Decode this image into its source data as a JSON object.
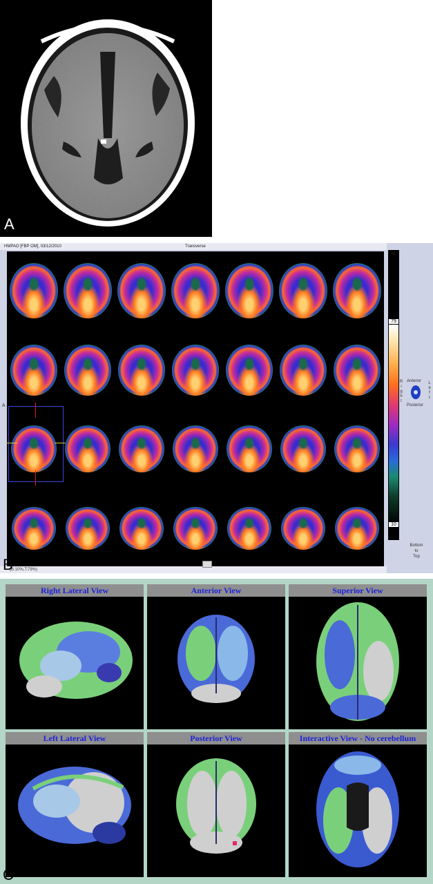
{
  "panel_a": {
    "letter": "A"
  },
  "panel_b": {
    "letter": "B",
    "header_title": "HMPAO [FBP OM], 03/12/2010",
    "orientation": "Transverse",
    "scale_unit": "%",
    "scale_max": "79",
    "scale_min": "10",
    "side_right": "Right",
    "side_left": "Left",
    "anterior": "Anterior",
    "posterior": "Posterior",
    "axis_a": "A",
    "order": [
      "Bottom",
      "to",
      "Top"
    ],
    "window": "(B:10%,T:79%)"
  },
  "panel_c": {
    "letter": "C",
    "views": [
      {
        "title": "Right Lateral View"
      },
      {
        "title": "Anterior View"
      },
      {
        "title": "Superior View"
      },
      {
        "title": "Left Lateral View"
      },
      {
        "title": "Posterior View"
      },
      {
        "title": "Interactive View - No cerebellum"
      }
    ]
  }
}
